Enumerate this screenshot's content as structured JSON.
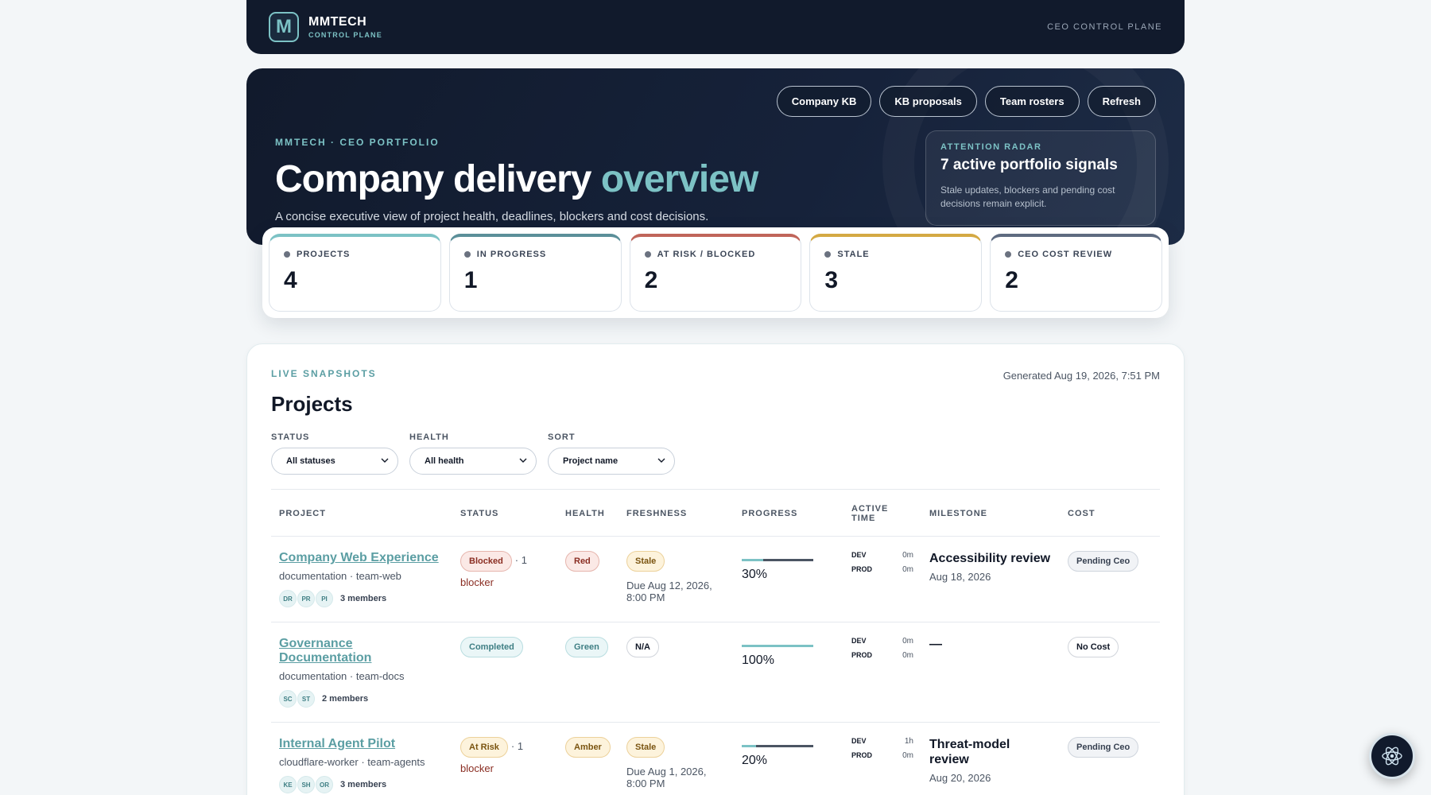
{
  "topbar": {
    "logo_letter": "M",
    "brand_name": "MMTECH",
    "brand_sub": "CONTROL PLANE",
    "right_label": "CEO CONTROL PLANE"
  },
  "hero": {
    "actions": [
      "Company KB",
      "KB proposals",
      "Team rosters",
      "Refresh"
    ],
    "eyebrow": "MMTECH · CEO PORTFOLIO",
    "title_main": "Company delivery ",
    "title_accent": "overview",
    "subtitle": "A concise executive view of project health, deadlines, blockers and cost decisions.",
    "radar": {
      "eyebrow": "ATTENTION RADAR",
      "title": "7 active portfolio signals",
      "body": "Stale updates, blockers and pending cost decisions remain explicit."
    }
  },
  "stats": [
    {
      "label": "PROJECTS",
      "value": "4",
      "color": "#7cc2c5"
    },
    {
      "label": "IN PROGRESS",
      "value": "1",
      "color": "#5b8f99"
    },
    {
      "label": "AT RISK / BLOCKED",
      "value": "2",
      "color": "#c0655a"
    },
    {
      "label": "STALE",
      "value": "3",
      "color": "#d4a943"
    },
    {
      "label": "CEO COST REVIEW",
      "value": "2",
      "color": "#5e6b80"
    }
  ],
  "projects_panel": {
    "eyebrow": "LIVE SNAPSHOTS",
    "generated": "Generated Aug 19, 2026, 7:51 PM",
    "title": "Projects",
    "filters": [
      {
        "label": "STATUS",
        "value": "All statuses"
      },
      {
        "label": "HEALTH",
        "value": "All health"
      },
      {
        "label": "SORT",
        "value": "Project name"
      }
    ],
    "columns": [
      "PROJECT",
      "STATUS",
      "HEALTH",
      "FRESHNESS",
      "PROGRESS",
      "ACTIVE TIME",
      "MILESTONE",
      "COST"
    ],
    "rows": [
      {
        "name": "Company Web Experience",
        "meta": "documentation · team-web",
        "avatars": [
          "DR",
          "PR",
          "PI"
        ],
        "members": "3 members",
        "status": "Blocked",
        "status_class": "b-blocked",
        "blocker_count": "· 1",
        "blocker_word": "blocker",
        "health": "Red",
        "health_class": "b-red",
        "freshness": "Stale",
        "freshness_class": "b-stale",
        "due": "Due Aug 12, 2026, 8:00 PM",
        "progress": 30,
        "progress_label": "30%",
        "dev": "0m",
        "prod": "0m",
        "milestone": "Accessibility review",
        "milestone_date": "Aug 18, 2026",
        "cost": "Pending Ceo",
        "cost_class": "b-pending"
      },
      {
        "name": "Governance Documentation",
        "meta": "documentation · team-docs",
        "avatars": [
          "SC",
          "ST"
        ],
        "members": "2 members",
        "status": "Completed",
        "status_class": "b-completed",
        "blocker_count": "",
        "blocker_word": "",
        "health": "Green",
        "health_class": "b-green",
        "freshness": "N/A",
        "freshness_class": "b-na",
        "due": "",
        "progress": 100,
        "progress_label": "100%",
        "dev": "0m",
        "prod": "0m",
        "milestone": "—",
        "milestone_date": "",
        "cost": "No Cost",
        "cost_class": "b-nocost"
      },
      {
        "name": "Internal Agent Pilot",
        "meta": "cloudflare-worker · team-agents",
        "avatars": [
          "KE",
          "SH",
          "OR"
        ],
        "members": "3 members",
        "status": "At Risk",
        "status_class": "b-atrisk",
        "blocker_count": "· 1",
        "blocker_word": "blocker",
        "health": "Amber",
        "health_class": "b-amber",
        "freshness": "Stale",
        "freshness_class": "b-stale",
        "due": "Due Aug 1, 2026, 8:00 PM",
        "progress": 20,
        "progress_label": "20%",
        "dev": "1h",
        "prod": "0m",
        "milestone": "Threat-model review",
        "milestone_date": "Aug 20, 2026",
        "cost": "Pending Ceo",
        "cost_class": "b-pending"
      }
    ],
    "time_labels": {
      "dev": "DEV",
      "prod": "PROD"
    }
  },
  "assistant_button": {
    "icon": "atom-icon"
  }
}
